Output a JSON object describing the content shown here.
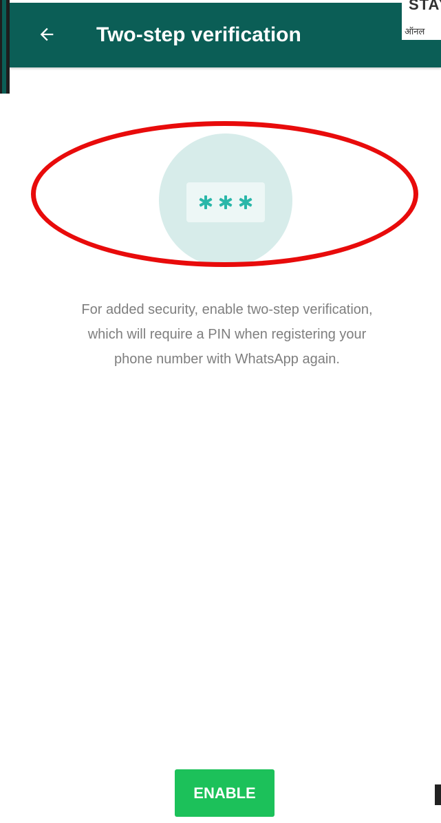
{
  "header": {
    "title": "Two-step verification",
    "back_icon": "arrow-left-icon"
  },
  "watermark": {
    "top_text": "STAY",
    "bottom_text": "ऑनल"
  },
  "illustration": {
    "pin_mask": "***",
    "circle_color": "#d7ecea",
    "asterisk_color": "#2ab7a9"
  },
  "annotation": {
    "ring_color": "#e80b0b"
  },
  "description": {
    "lines": [
      "For added security, enable two-step verification,",
      "which will require a PIN when registering your",
      "phone number with WhatsApp again."
    ]
  },
  "actions": {
    "enable_label": "ENABLE",
    "enable_color": "#1cc15a"
  },
  "colors": {
    "app_bar": "#0b5e56",
    "text_secondary": "#7e7e7e"
  }
}
